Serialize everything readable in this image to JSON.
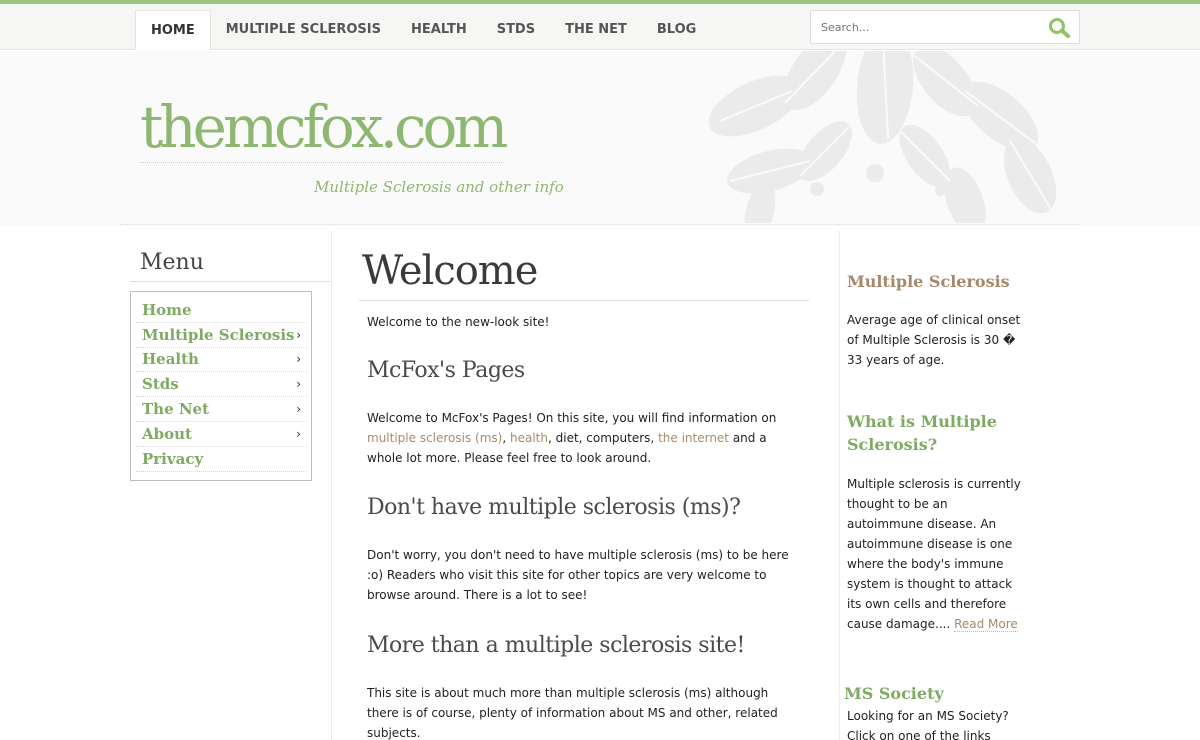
{
  "nav": {
    "items": [
      "HOME",
      "MULTIPLE SCLEROSIS",
      "HEALTH",
      "STDS",
      "THE NET",
      "BLOG"
    ]
  },
  "search": {
    "placeholder": "Search..."
  },
  "header": {
    "site_title": "themcfox.com",
    "tagline": "Multiple Sclerosis and other info"
  },
  "sidebar": {
    "menu_title": "Menu",
    "items": [
      {
        "label": "Home",
        "chevron": ""
      },
      {
        "label": "Multiple Sclerosis",
        "chevron": "›"
      },
      {
        "label": "Health",
        "chevron": "›"
      },
      {
        "label": "Stds",
        "chevron": "›"
      },
      {
        "label": "The Net",
        "chevron": "›"
      },
      {
        "label": "About",
        "chevron": "›"
      },
      {
        "label": "Privacy",
        "chevron": ""
      }
    ]
  },
  "main": {
    "title": "Welcome",
    "intro": "Welcome to the new-look site!",
    "section1": {
      "heading": "McFox's Pages",
      "text_a": "Welcome to McFox's Pages! On this site, you will find information on ",
      "link_ms": "multiple sclerosis (ms)",
      "sep1": ", ",
      "link_health": "health",
      "text_b": ", diet, computers, ",
      "link_internet": "the internet",
      "text_c": " and a whole lot more. Please feel free to look around."
    },
    "section2": {
      "heading": "Don't have multiple sclerosis (ms)?",
      "text": "Don't worry, you don't need to have multiple sclerosis (ms) to be here :o) Readers who visit this site for other topics are very welcome to browse around. There is a lot to see!"
    },
    "section3": {
      "heading": "More than a multiple sclerosis site!",
      "text": "This site is about much more than multiple sclerosis (ms) although there is of course, plenty of information about MS and other, related subjects."
    }
  },
  "right": {
    "block1": {
      "heading": "Multiple Sclerosis",
      "text": "Average age of clinical onset of Multiple Sclerosis is 30 � 33 years of age."
    },
    "block2": {
      "heading": "What is Multiple Sclerosis?",
      "text": "Multiple sclerosis is currently thought to be an autoimmune disease. An autoimmune disease is one where the body's immune system is thought to attack its own cells and therefore cause damage.... ",
      "read_more": "Read More"
    },
    "block3": {
      "heading": "MS Society",
      "text": "Looking for an MS Society? Click on one of the links"
    }
  },
  "colors": {
    "accent_green": "#8eb872",
    "link_brown": "#a98a6a",
    "heading_brown": "#a8876a"
  }
}
